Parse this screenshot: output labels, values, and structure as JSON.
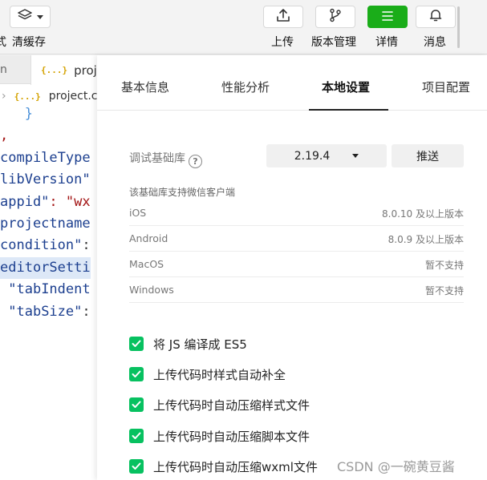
{
  "toolbar": {
    "left_partial": "式",
    "clear_cache": "清缓存",
    "buttons": [
      {
        "label": "上传",
        "icon": "upload-icon"
      },
      {
        "label": "版本管理",
        "icon": "branch-icon"
      },
      {
        "label": "详情",
        "icon": "menu-icon"
      },
      {
        "label": "消息",
        "icon": "bell-icon"
      }
    ]
  },
  "editor": {
    "tab_prev_partial": "n",
    "active_tab": "project.c",
    "breadcrumb": "project.c",
    "lines": [
      {
        "indent": "   ",
        "key": "",
        "rest": "}",
        "type": "brace"
      },
      {
        "indent": "",
        "key": "",
        "rest": ",",
        "type": "comma"
      },
      {
        "indent": "",
        "key": "compileType",
        "rest": "",
        "type": "key"
      },
      {
        "indent": "",
        "key": "libVersion\"",
        "rest": "",
        "type": "key"
      },
      {
        "indent": "",
        "key": "appid\"",
        "rest": ": \"wx",
        "type": "keystr"
      },
      {
        "indent": "",
        "key": "projectname",
        "rest": "",
        "type": "key"
      },
      {
        "indent": "",
        "key": "condition\"",
        "rest": ":",
        "type": "key"
      },
      {
        "indent": "",
        "key": "editorSetti",
        "rest": "",
        "type": "key-hl"
      },
      {
        "indent": " ",
        "key": "\"tabIndent",
        "rest": "",
        "type": "key"
      },
      {
        "indent": " ",
        "key": "\"tabSize\"",
        "rest": ":",
        "type": "key"
      }
    ]
  },
  "panel": {
    "tabs": [
      "基本信息",
      "性能分析",
      "本地设置",
      "项目配置"
    ],
    "active_tab": "本地设置",
    "debug_lib_label": "调试基础库",
    "debug_lib_version": "2.19.4",
    "push_label": "推送",
    "support_note": "该基础库支持微信客户端",
    "platforms": [
      {
        "name": "iOS",
        "value": "8.0.10 及以上版本"
      },
      {
        "name": "Android",
        "value": "8.0.9 及以上版本"
      },
      {
        "name": "MacOS",
        "value": "暂不支持"
      },
      {
        "name": "Windows",
        "value": "暂不支持"
      }
    ],
    "options": [
      {
        "label": "将 JS 编译成 ES5",
        "checked": true
      },
      {
        "label": "上传代码时样式自动补全",
        "checked": true
      },
      {
        "label": "上传代码时自动压缩样式文件",
        "checked": true
      },
      {
        "label": "上传代码时自动压缩脚本文件",
        "checked": true
      },
      {
        "label": "上传代码时自动压缩wxml文件",
        "checked": true
      }
    ]
  },
  "watermark": "CSDN @一碗黄豆酱",
  "colors": {
    "accent_green": "#07c160",
    "toolbar_green": "#1aad19"
  }
}
